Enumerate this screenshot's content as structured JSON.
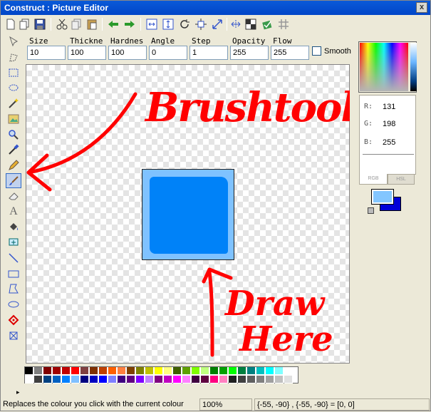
{
  "window": {
    "title": "Construct : Picture Editor",
    "close_label": "x"
  },
  "toolbar": {
    "icons": [
      "new-icon",
      "copy-page-icon",
      "save-icon",
      "cut-icon",
      "copy-icon",
      "paste-icon",
      "undo-arrow-icon",
      "redo-arrow-icon",
      "resize-canvas-icon",
      "crop-icon",
      "rotate-icon",
      "move-icon",
      "resize-icon",
      "transparency-icon",
      "apply-icon",
      "grid-icon"
    ]
  },
  "params": {
    "size": {
      "label": "Size",
      "value": "10"
    },
    "thickness": {
      "label": "Thickne",
      "value": "100"
    },
    "hardness": {
      "label": "Hardnes",
      "value": "100"
    },
    "angle": {
      "label": "Angle",
      "value": "0"
    },
    "step": {
      "label": "Step",
      "value": "1"
    },
    "opacity": {
      "label": "Opacity",
      "value": "255"
    },
    "flow": {
      "label": "Flow",
      "value": "255"
    },
    "smooth_label": "Smooth",
    "smooth_checked": false
  },
  "tools": [
    "select-pointer-icon",
    "lasso-icon",
    "rect-select-icon",
    "ellipse-select-icon",
    "magic-wand-icon",
    "image-icon",
    "zoom-icon",
    "eyedropper-icon",
    "pencil-icon",
    "brush-icon",
    "eraser-icon",
    "text-icon",
    "fill-bucket-icon",
    "hotspot-icon",
    "line-icon",
    "rectangle-icon",
    "polygon-icon",
    "ellipse-icon",
    "action-point-icon",
    "bounding-box-icon"
  ],
  "active_tool": "brush-icon",
  "annotations": {
    "brush_tool": "Brushtool",
    "draw_here_1": "Draw",
    "draw_here_2": "Here"
  },
  "color": {
    "r_label": "R:",
    "r": "131",
    "g_label": "G:",
    "g": "198",
    "b_label": "B:",
    "b": "255",
    "tab_rgb": "RGB",
    "tab_hsl": "HSL",
    "primary": "#83c6ff",
    "secondary": "#0000d8",
    "picture_bg": "#7fc2ff",
    "picture_fill": "#0082f8"
  },
  "palette": {
    "row1": [
      "#000000",
      "#808080",
      "#800000",
      "#a00000",
      "#c00000",
      "#ff0000",
      "#804040",
      "#803000",
      "#c04000",
      "#ff6000",
      "#ff8040",
      "#804000",
      "#808000",
      "#c0c000",
      "#ffff00",
      "#ffff80",
      "#406000",
      "#60a000",
      "#80ff00",
      "#c0ff80",
      "#008000",
      "#00a000",
      "#00ff00",
      "#008040",
      "#008080",
      "#00c0c0",
      "#00ffff",
      "#80ffff",
      "#ffffff"
    ],
    "row2": [
      "#ffffff",
      "#404040",
      "#004080",
      "#0060c0",
      "#0080ff",
      "#80c0ff",
      "#000080",
      "#0000c0",
      "#0000ff",
      "#8080ff",
      "#400080",
      "#600080",
      "#8000ff",
      "#c080ff",
      "#800080",
      "#c000c0",
      "#ff00ff",
      "#ff80ff",
      "#400040",
      "#600040",
      "#ff0080",
      "#ff80c0",
      "#202020",
      "#404040",
      "#606060",
      "#808080",
      "#a0a0a0",
      "#c0c0c0",
      "#e0e0e0"
    ]
  },
  "status": {
    "message": "Replaces the colour you click with the current colour",
    "zoom": "100%",
    "coords": "{-55, -90} , {-55, -90} = [0, 0]"
  }
}
